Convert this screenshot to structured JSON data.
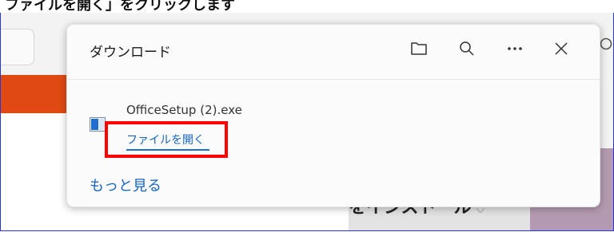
{
  "caption": {
    "text": "ファイルを開く」をクリックします"
  },
  "panel": {
    "title": "ダウンロード",
    "toolbar_icons": [
      "folder-icon",
      "search-icon",
      "more-icon",
      "close-icon"
    ]
  },
  "download": {
    "file_name": "OfficeSetup (2).exe",
    "open_label": "ファイルを開く"
  },
  "more_label": "もっと見る",
  "background": {
    "install_label": "をインストール"
  },
  "colors": {
    "accent": "#1665c0",
    "highlight": "#ff0000",
    "banner": "#e04a12"
  }
}
